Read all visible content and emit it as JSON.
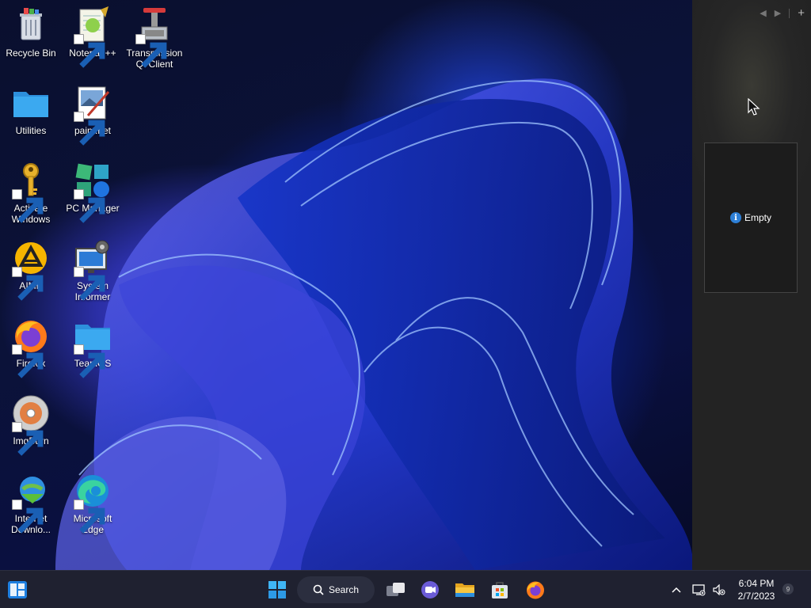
{
  "desktop_icons": [
    {
      "id": "recycle-bin",
      "label": "Recycle Bin",
      "icon": "recycle-bin-icon",
      "shortcut": false
    },
    {
      "id": "notepad-plus-plus",
      "label": "Notepad++",
      "icon": "notepad-plus-plus-icon",
      "shortcut": true
    },
    {
      "id": "transmission",
      "label": "Transmission Qt Client",
      "icon": "transmission-icon",
      "shortcut": true
    },
    {
      "id": "utilities",
      "label": "Utilities",
      "icon": "folder-icon",
      "shortcut": false
    },
    {
      "id": "paint-net",
      "label": "paint.net",
      "icon": "paint-net-icon",
      "shortcut": true
    },
    {
      "id": "activate-windows",
      "label": "Activate Windows",
      "icon": "key-icon",
      "shortcut": true
    },
    {
      "id": "pc-manager",
      "label": "PC Manager",
      "icon": "pc-manager-icon",
      "shortcut": true
    },
    {
      "id": "aimp",
      "label": "AIMP",
      "icon": "aimp-icon",
      "shortcut": true
    },
    {
      "id": "system-informer",
      "label": "System Informer",
      "icon": "system-informer-icon",
      "shortcut": true
    },
    {
      "id": "firefox",
      "label": "Firefox",
      "icon": "firefox-icon",
      "shortcut": true
    },
    {
      "id": "teamos",
      "label": "TeamOS",
      "icon": "folder-icon",
      "shortcut": true
    },
    {
      "id": "imgburn",
      "label": "ImgBurn",
      "icon": "imgburn-disc-icon",
      "shortcut": true
    },
    {
      "id": "internet-download",
      "label": "Internet Downlo...",
      "icon": "internet-download-manager-icon",
      "shortcut": true
    },
    {
      "id": "microsoft-edge",
      "label": "Microsoft Edge",
      "icon": "edge-icon",
      "shortcut": true
    }
  ],
  "side_panel": {
    "empty_label": "Empty",
    "nav": {
      "prev": "◀",
      "next": "▶",
      "add": "+"
    }
  },
  "taskbar": {
    "search_label": "Search",
    "pinned": [
      "widgets-icon",
      "start-icon",
      "task-view-icon",
      "teams-chat-icon",
      "file-explorer-icon",
      "microsoft-store-icon",
      "firefox-icon"
    ],
    "clock_time": "6:04 PM",
    "clock_date": "2/7/2023",
    "notification_count": "9"
  },
  "colors": {
    "taskbar_bg": "#1f2130",
    "panel_bg": "#262626",
    "accent_blue": "#2d7fd6",
    "folder": "#3ba9f0"
  }
}
